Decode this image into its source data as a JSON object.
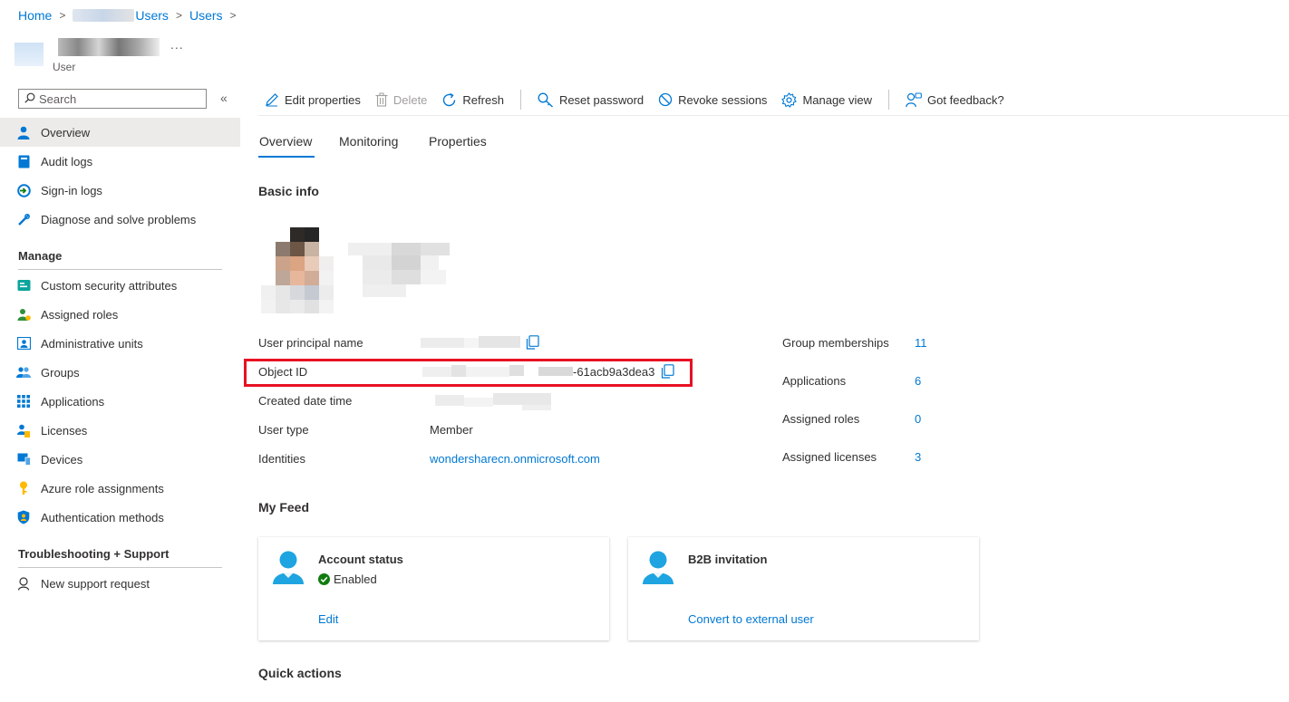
{
  "breadcrumb": {
    "home": "Home",
    "directory_tail": "Users",
    "users": "Users"
  },
  "header": {
    "more": "...",
    "subtitle": "User"
  },
  "sidebar": {
    "search_placeholder": "Search",
    "collapse": "«",
    "items": [
      {
        "label": "Overview",
        "icon": "person-icon",
        "active": true
      },
      {
        "label": "Audit logs",
        "icon": "book-icon"
      },
      {
        "label": "Sign-in logs",
        "icon": "sign-in-icon"
      },
      {
        "label": "Diagnose and solve problems",
        "icon": "wrench-icon"
      }
    ],
    "manage_header": "Manage",
    "manage_items": [
      {
        "label": "Custom security attributes",
        "icon": "attributes-icon"
      },
      {
        "label": "Assigned roles",
        "icon": "roles-icon"
      },
      {
        "label": "Administrative units",
        "icon": "admin-units-icon"
      },
      {
        "label": "Groups",
        "icon": "groups-icon"
      },
      {
        "label": "Applications",
        "icon": "apps-grid-icon"
      },
      {
        "label": "Licenses",
        "icon": "licenses-icon"
      },
      {
        "label": "Devices",
        "icon": "devices-icon"
      },
      {
        "label": "Azure role assignments",
        "icon": "key-icon"
      },
      {
        "label": "Authentication methods",
        "icon": "shield-icon"
      }
    ],
    "support_header": "Troubleshooting + Support",
    "support_items": [
      {
        "label": "New support request",
        "icon": "support-icon"
      }
    ]
  },
  "toolbar": {
    "edit": "Edit properties",
    "delete": "Delete",
    "refresh": "Refresh",
    "reset_password": "Reset password",
    "revoke_sessions": "Revoke sessions",
    "manage_view": "Manage view",
    "feedback": "Got feedback?"
  },
  "tabs": [
    "Overview",
    "Monitoring",
    "Properties"
  ],
  "basic_info": {
    "title": "Basic info",
    "fields": {
      "upn_label": "User principal name",
      "object_id_label": "Object ID",
      "object_id_value": "-61acb9a3dea3",
      "created_label": "Created date time",
      "user_type_label": "User type",
      "user_type_value": "Member",
      "identities_label": "Identities",
      "identities_value": "wondersharecn.onmicrosoft.com"
    },
    "stats": [
      {
        "label": "Group memberships",
        "value": "11"
      },
      {
        "label": "Applications",
        "value": "6"
      },
      {
        "label": "Assigned roles",
        "value": "0"
      },
      {
        "label": "Assigned licenses",
        "value": "3"
      }
    ]
  },
  "feed": {
    "title": "My Feed",
    "cards": [
      {
        "title": "Account status",
        "status": "Enabled",
        "link": "Edit"
      },
      {
        "title": "B2B invitation",
        "link": "Convert to external user"
      }
    ]
  },
  "quick_actions": {
    "title": "Quick actions"
  },
  "colors": {
    "accent": "#0078d4",
    "highlight": "#e81123",
    "success": "#107c10",
    "selected": "#edebe9"
  }
}
